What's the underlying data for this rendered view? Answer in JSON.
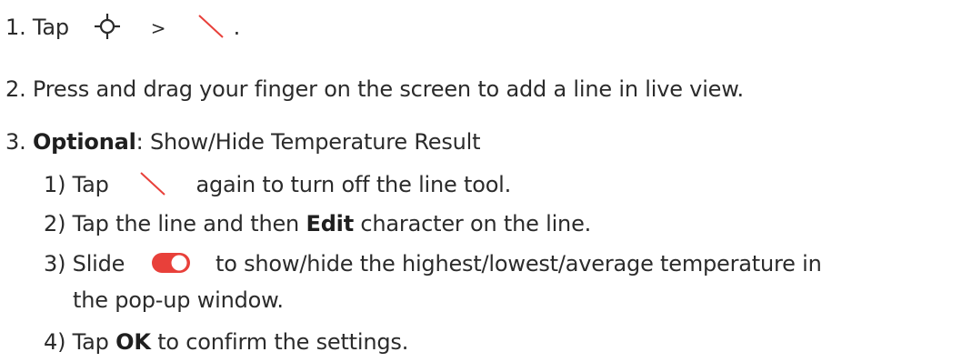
{
  "steps": {
    "step1": {
      "prefix": "1. Tap",
      "separator": ">",
      "suffix": ".",
      "icons": [
        "crosshair-icon",
        "line-tool-icon"
      ]
    },
    "step2": {
      "text": "2. Press and drag your finger on the screen to add a line in live view."
    },
    "step3": {
      "number": "3.",
      "label": "Optional",
      "text": ": Show/Hide Temperature Result",
      "substeps": {
        "s1": {
          "prefix": "1) Tap",
          "suffix": "again to turn off the line tool.",
          "icon": "line-tool-icon"
        },
        "s2": {
          "prefix": "2) Tap the line and then",
          "bold": "Edit",
          "suffix": "character on the line."
        },
        "s3": {
          "prefix": "3) Slide",
          "suffix": "to show/hide the highest/lowest/average temperature in",
          "continuation": "the pop-up window.",
          "icon": "toggle-switch-icon",
          "toggle_state": "on"
        },
        "s4": {
          "prefix": "4) Tap",
          "bold": "OK",
          "suffix": "to confirm the settings."
        }
      }
    }
  },
  "colors": {
    "accent": "#e8403a",
    "text": "#2b2b2b"
  }
}
